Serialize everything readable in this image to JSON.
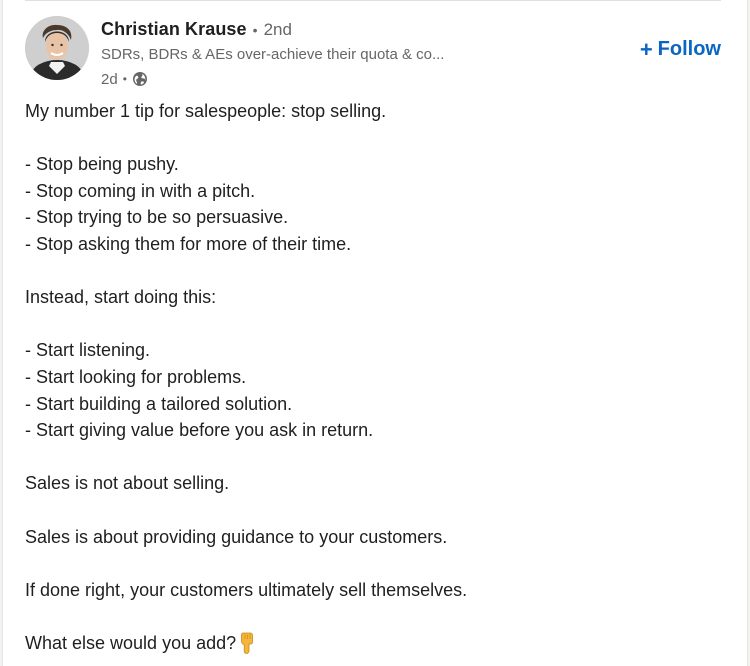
{
  "post": {
    "author": {
      "name": "Christian Krause",
      "connection": "2nd",
      "headline": "SDRs, BDRs & AEs over-achieve their quota & co...",
      "time": "2d",
      "visibility_icon": "globe-icon",
      "avatar_icon": "person-avatar"
    },
    "follow": {
      "plus": "+",
      "label": "Follow"
    },
    "lines": [
      "My number 1 tip for salespeople: stop selling.",
      "",
      "- Stop being pushy.",
      "- Stop coming in with a pitch.",
      "- Stop trying to be so persuasive.",
      "- Stop asking them for more of their time.",
      "",
      "Instead, start doing this:",
      "",
      "- Start listening.",
      "- Start looking for problems.",
      "- Start building a tailored solution.",
      "- Start giving value before you ask in return.",
      "",
      "Sales is not about selling.",
      "",
      "Sales is about providing guidance to your customers.",
      "",
      "If done right, your customers ultimately sell themselves.",
      "",
      "What else would you add?"
    ],
    "last_line_emoji": "pointing-down-hand-icon"
  },
  "colors": {
    "accent": "#0a66c2",
    "text_primary": "#1f1f1f",
    "text_secondary": "#666666",
    "emoji_yellow": "#f5b53a"
  },
  "separator": "•"
}
